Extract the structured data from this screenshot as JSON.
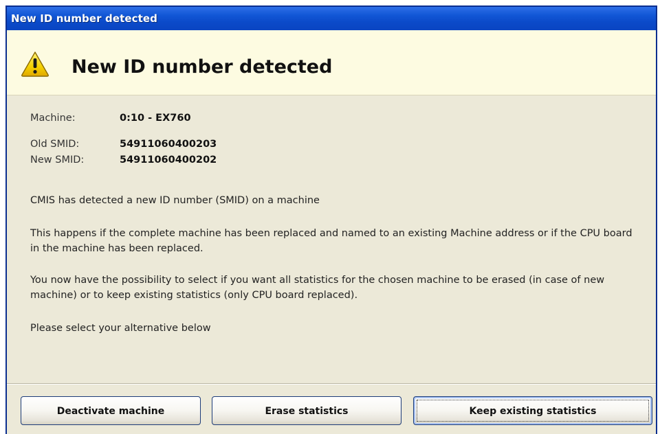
{
  "window": {
    "title": "New ID number detected"
  },
  "header": {
    "title": "New ID number detected",
    "icon": "warning-icon"
  },
  "details": {
    "machine_label": "Machine:",
    "machine_value": "0:10 - EX760",
    "old_smid_label": "Old SMID:",
    "old_smid_value": "54911060400203",
    "new_smid_label": "New SMID:",
    "new_smid_value": "54911060400202"
  },
  "message": {
    "p1": "CMIS has detected a new ID number (SMID) on a machine",
    "p2": "This happens if the complete machine has been replaced and named to an existing Machine address or if the CPU board in the machine has been replaced.",
    "p3": "You now have the possibility to select if you want all statistics for the chosen machine to be erased (in case of new machine) or to keep existing statistics (only CPU board replaced).",
    "p4": "Please select your alternative below"
  },
  "buttons": {
    "deactivate": "Deactivate machine",
    "erase": "Erase statistics",
    "keep": "Keep existing statistics"
  },
  "colors": {
    "titlebar": "#0b4ac9",
    "header_bg": "#fdfbe1",
    "dialog_bg": "#ece9d8",
    "warning_fill": "#f5d100"
  }
}
